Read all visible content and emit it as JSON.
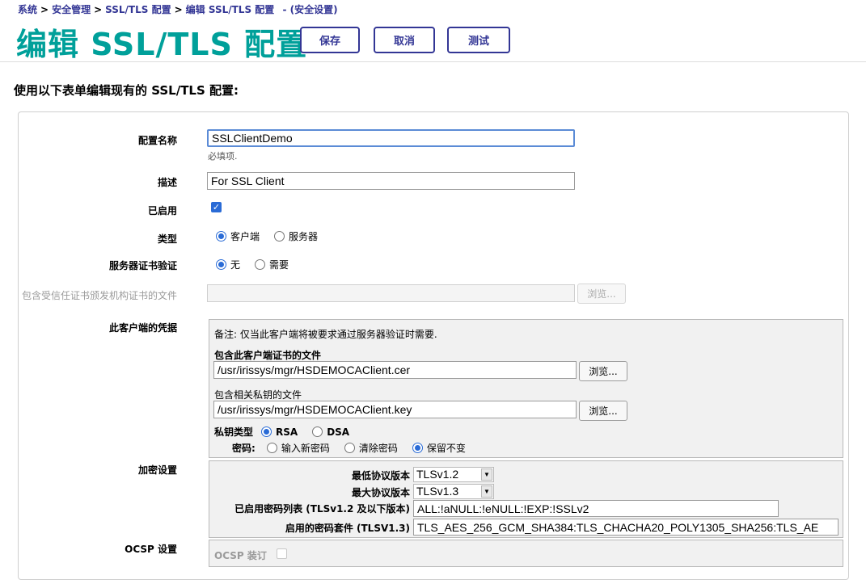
{
  "breadcrumb": {
    "items": [
      "系统",
      "安全管理",
      "SSL/TLS 配置",
      "编辑 SSL/TLS 配置"
    ],
    "separator": ">",
    "note": "- (安全设置)"
  },
  "page_title": "编辑 SSL/TLS 配置",
  "toolbar": {
    "save_label": "保存",
    "cancel_label": "取消",
    "test_label": "测试"
  },
  "intro": "使用以下表单编辑现有的 SSL/TLS 配置:",
  "form": {
    "config_name": {
      "label": "配置名称",
      "value": "SSLClientDemo",
      "hint": "必填项."
    },
    "description": {
      "label": "描述",
      "value": "For SSL Client"
    },
    "enabled": {
      "label": "已启用",
      "checked": true
    },
    "type": {
      "label": "类型",
      "options": [
        "客户端",
        "服务器"
      ],
      "selected": "客户端"
    },
    "server_cert_verify": {
      "label": "服务器证书验证",
      "options": [
        "无",
        "需要"
      ],
      "selected": "无"
    },
    "ca_file": {
      "label": "包含受信任证书颁发机构证书的文件",
      "value": "",
      "browse_label": "浏览..."
    },
    "client_credentials": {
      "label": "此客户端的凭据",
      "note": "备注: 仅当此客户端将被要求通过服务器验证时需要.",
      "cert_file_label": "包含此客户端证书的文件",
      "cert_file_value": "/usr/irissys/mgr/HSDEMOCAClient.cer",
      "key_file_label": "包含相关私钥的文件",
      "key_file_value": "/usr/irissys/mgr/HSDEMOCAClient.key",
      "browse_label": "浏览...",
      "key_type_label": "私钥类型",
      "key_type_options": [
        "RSA",
        "DSA"
      ],
      "key_type_selected": "RSA",
      "password_label": "密码:",
      "password_options": [
        "输入新密码",
        "清除密码",
        "保留不变"
      ],
      "password_selected": "保留不变"
    },
    "encryption": {
      "label": "加密设置",
      "min_protocol_label": "最低协议版本",
      "min_protocol_value": "TLSv1.2",
      "max_protocol_label": "最大协议版本",
      "max_protocol_value": "TLSv1.3",
      "cipher_list_label": "已启用密码列表 (TLSv1.2 及以下版本)",
      "cipher_list_value": "ALL:!aNULL:!eNULL:!EXP:!SSLv2",
      "cipher_suites_label": "启用的密码套件 (TLSV1.3)",
      "cipher_suites_value": "TLS_AES_256_GCM_SHA384:TLS_CHACHA20_POLY1305_SHA256:TLS_AE"
    },
    "ocsp": {
      "label": "OCSP 设置",
      "stapling_label": "OCSP 装订",
      "stapling_checked": false
    }
  },
  "colors": {
    "accent": "#00A09A",
    "link": "#333695",
    "selected": "#2a6bd6"
  }
}
